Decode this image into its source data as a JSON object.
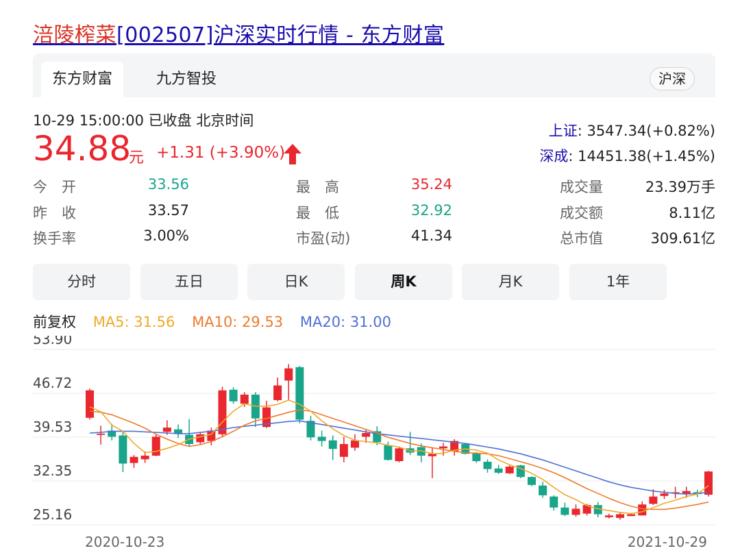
{
  "header": {
    "title_highlight": "涪陵榨菜",
    "title_rest": "[002507]沪深实时行情 - 东方财富"
  },
  "tabs": [
    {
      "label": "东方财富",
      "active": true
    },
    {
      "label": "九方智投",
      "active": false
    }
  ],
  "market_badge": "沪深",
  "quote": {
    "timestamp": "10-29 15:00:00  已收盘  北京时间",
    "price": "34.88",
    "unit": "元",
    "change": "+1.31 (+3.90%)",
    "up_color": "#e8272e",
    "down_color": "#18a58a"
  },
  "indices": [
    {
      "name": "上证",
      "value": ": 3547.34(+0.82%)"
    },
    {
      "name": "深成",
      "value": ": 14451.38(+1.45%)"
    }
  ],
  "stats": [
    {
      "label": "今　开",
      "value": "33.56",
      "tone": "down"
    },
    {
      "label": "最　高",
      "value": "35.24",
      "tone": "up"
    },
    {
      "label": "成交量",
      "value": "23.39万手",
      "tone": "plain"
    },
    {
      "label": "昨　收",
      "value": "33.57",
      "tone": "plain"
    },
    {
      "label": "最　低",
      "value": "32.92",
      "tone": "down"
    },
    {
      "label": "成交额",
      "value": "8.11亿",
      "tone": "plain"
    },
    {
      "label": "换手率",
      "value": "3.00%",
      "tone": "plain"
    },
    {
      "label": "市盈(动)",
      "value": "41.34",
      "tone": "plain"
    },
    {
      "label": "总市值",
      "value": "309.61亿",
      "tone": "plain"
    }
  ],
  "periods": [
    {
      "label": "分时",
      "active": false
    },
    {
      "label": "五日",
      "active": false
    },
    {
      "label": "日K",
      "active": false
    },
    {
      "label": "周K",
      "active": true
    },
    {
      "label": "月K",
      "active": false
    },
    {
      "label": "1年",
      "active": false
    }
  ],
  "ma_legend": {
    "adjust": "前复权",
    "ma5": "MA5: 31.56",
    "ma10": "MA10: 29.53",
    "ma20": "MA20: 31.00",
    "ma5_color": "#f0a92a",
    "ma10_color": "#ee7a2e",
    "ma20_color": "#4f6fd6"
  },
  "chart_data": {
    "type": "candlestick",
    "y_ticks": [
      "53.90",
      "46.72",
      "39.53",
      "32.35",
      "25.16"
    ],
    "ylim": [
      25.16,
      53.9
    ],
    "x_start": "2020-10-23",
    "x_end": "2021-10-29",
    "grid": true,
    "candles": [
      [
        42.7,
        47.2,
        47.5,
        42.4
      ],
      [
        39.9,
        40.1,
        41.4,
        38.3
      ],
      [
        40.6,
        39.6,
        41.7,
        39.0
      ],
      [
        39.8,
        35.2,
        40.4,
        33.8
      ],
      [
        35.3,
        36.3,
        36.6,
        34.5
      ],
      [
        35.9,
        36.5,
        37.2,
        35.3
      ],
      [
        36.5,
        39.6,
        40.0,
        36.4
      ],
      [
        40.4,
        41.1,
        42.3,
        39.9
      ],
      [
        40.8,
        40.1,
        41.6,
        39.4
      ],
      [
        39.9,
        38.4,
        42.5,
        38.0
      ],
      [
        38.7,
        40.0,
        40.3,
        38.4
      ],
      [
        38.9,
        40.6,
        41.1,
        38.2
      ],
      [
        40.0,
        47.2,
        47.8,
        39.7
      ],
      [
        47.3,
        45.4,
        47.7,
        45.0
      ],
      [
        45.0,
        46.5,
        46.9,
        44.5
      ],
      [
        46.5,
        42.6,
        46.9,
        41.2
      ],
      [
        41.2,
        44.4,
        45.5,
        41.0
      ],
      [
        45.6,
        48.0,
        49.3,
        45.4
      ],
      [
        48.8,
        50.8,
        51.5,
        45.6
      ],
      [
        51.0,
        42.4,
        51.2,
        41.8
      ],
      [
        42.2,
        39.5,
        43.0,
        39.0
      ],
      [
        39.6,
        38.9,
        40.6,
        38.0
      ],
      [
        39.0,
        37.6,
        39.8,
        35.8
      ],
      [
        36.3,
        38.4,
        39.6,
        35.4
      ],
      [
        37.8,
        39.0,
        40.0,
        37.3
      ],
      [
        39.6,
        40.2,
        40.7,
        38.6
      ],
      [
        40.5,
        38.7,
        41.3,
        38.2
      ],
      [
        38.2,
        35.8,
        38.8,
        35.7
      ],
      [
        35.6,
        37.7,
        38.0,
        35.4
      ],
      [
        37.7,
        37.0,
        40.4,
        36.6
      ],
      [
        37.9,
        36.5,
        38.5,
        35.4
      ],
      [
        36.4,
        36.8,
        37.8,
        32.8
      ],
      [
        37.7,
        38.0,
        38.6,
        36.5
      ],
      [
        37.2,
        38.9,
        39.2,
        36.5
      ],
      [
        38.4,
        36.8,
        38.4,
        36.7
      ],
      [
        36.9,
        35.6,
        37.1,
        35.3
      ],
      [
        35.5,
        34.3,
        35.9,
        33.7
      ],
      [
        34.4,
        33.7,
        35.0,
        33.5
      ],
      [
        33.6,
        34.7,
        34.9,
        33.5
      ],
      [
        34.9,
        33.0,
        35.0,
        32.8
      ],
      [
        33.0,
        31.7,
        33.1,
        31.5
      ],
      [
        31.6,
        30.0,
        32.2,
        29.6
      ],
      [
        29.8,
        28.0,
        30.0,
        27.5
      ],
      [
        28.0,
        26.8,
        28.8,
        26.6
      ],
      [
        26.8,
        27.8,
        28.5,
        26.5
      ],
      [
        27.0,
        28.4,
        28.6,
        26.7
      ],
      [
        28.4,
        26.9,
        28.9,
        26.4
      ],
      [
        26.4,
        26.7,
        27.0,
        26.2
      ],
      [
        26.3,
        26.9,
        27.2,
        26.0
      ],
      [
        26.6,
        26.9,
        27.1,
        26.6
      ],
      [
        26.7,
        28.5,
        29.0,
        26.7
      ],
      [
        28.6,
        29.8,
        31.0,
        28.4
      ],
      [
        29.9,
        30.3,
        30.9,
        29.4
      ],
      [
        30.5,
        30.5,
        31.4,
        29.5
      ],
      [
        30.3,
        30.7,
        31.4,
        29.6
      ],
      [
        30.5,
        30.2,
        30.9,
        29.7
      ],
      [
        30.1,
        33.9,
        34.0,
        29.8
      ]
    ],
    "ma5": [
      44.5,
      43.7,
      41.5,
      40.5,
      38.5,
      37.0,
      37.2,
      37.7,
      38.3,
      39.2,
      39.6,
      40.0,
      42.0,
      43.8,
      45.0,
      44.6,
      44.6,
      44.9,
      45.6,
      44.9,
      43.8,
      42.2,
      40.9,
      39.8,
      39.0,
      38.8,
      38.6,
      38.2,
      37.9,
      37.3,
      37.3,
      36.8,
      36.9,
      37.4,
      37.6,
      37.4,
      36.9,
      35.8,
      35.0,
      34.4,
      33.6,
      32.6,
      31.3,
      30.1,
      29.3,
      28.3,
      27.8,
      27.5,
      27.2,
      27.0,
      27.3,
      28.0,
      28.7,
      29.2,
      29.8,
      30.2,
      31.6
    ],
    "ma10": [
      43.8,
      43.6,
      43.2,
      42.5,
      41.8,
      41.0,
      40.0,
      39.2,
      38.5,
      38.0,
      38.3,
      38.8,
      39.6,
      40.5,
      41.5,
      42.2,
      42.6,
      43.1,
      43.6,
      44.0,
      43.8,
      43.2,
      42.6,
      42.0,
      41.4,
      40.8,
      40.2,
      39.5,
      39.0,
      38.5,
      38.1,
      37.8,
      37.5,
      37.2,
      37.0,
      36.9,
      36.8,
      36.5,
      36.0,
      35.5,
      35.0,
      34.4,
      33.7,
      32.9,
      32.0,
      31.1,
      30.3,
      29.5,
      28.8,
      28.2,
      27.8,
      27.7,
      27.7,
      27.9,
      28.2,
      28.5,
      28.9
    ],
    "ma20": [
      40.2,
      40.3,
      40.5,
      40.5,
      40.5,
      40.4,
      40.3,
      40.2,
      40.1,
      40.1,
      40.3,
      40.5,
      40.8,
      41.1,
      41.3,
      41.5,
      41.7,
      41.9,
      42.1,
      42.2,
      41.9,
      41.6,
      41.3,
      41.0,
      40.7,
      40.4,
      40.1,
      39.9,
      39.7,
      39.5,
      39.3,
      39.1,
      38.9,
      38.7,
      38.5,
      38.2,
      37.9,
      37.6,
      37.2,
      36.8,
      36.3,
      35.8,
      35.2,
      34.6,
      34.0,
      33.4,
      32.8,
      32.2,
      31.7,
      31.3,
      31.0,
      30.7,
      30.5,
      30.3,
      30.2,
      30.3,
      30.5
    ]
  }
}
